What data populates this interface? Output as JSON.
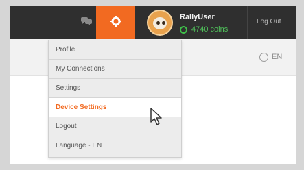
{
  "header": {
    "username": "RallyUser",
    "coins": "4740 coins",
    "logout_label": "Log Out",
    "accent_color": "#f26a21",
    "coins_color": "#4fbf5a"
  },
  "subheader": {
    "language": "EN"
  },
  "dropdown": {
    "items": [
      {
        "label": "Profile"
      },
      {
        "label": "My Connections"
      },
      {
        "label": "Settings"
      },
      {
        "label": "Device Settings"
      },
      {
        "label": "Logout"
      },
      {
        "label": "Language - EN"
      }
    ],
    "active_index": 3
  },
  "icons": {
    "chat": "chat-bubbles-icon",
    "settings": "gear-icon",
    "coins": "coin-icon",
    "language": "globe-icon",
    "cursor": "mouse-pointer-icon"
  }
}
